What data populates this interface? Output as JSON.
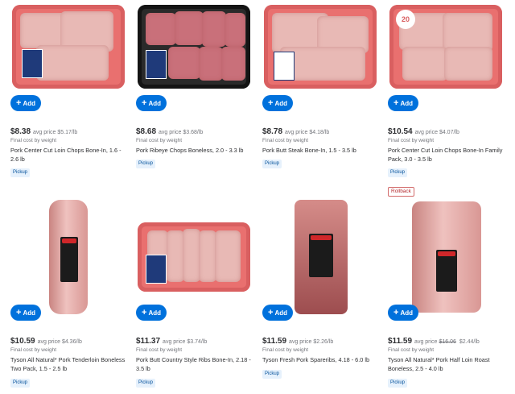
{
  "add_label": "Add",
  "products": [
    {
      "price": "$8.38",
      "avg": "avg price $5.17/lb",
      "final": "Final cost by weight",
      "name": "Pork Center Cut Loin Chops Bone-In, 1.6 - 2.6 lb",
      "pickup": "Pickup"
    },
    {
      "price": "$8.68",
      "avg": "avg price $3.68/lb",
      "final": "Final cost by weight",
      "name": "Pork Ribeye Chops Boneless, 2.0 - 3.3 lb",
      "pickup": "Pickup"
    },
    {
      "price": "$8.78",
      "avg": "avg price $4.18/lb",
      "final": "Final cost by weight",
      "name": "Pork Butt Steak Bone-In, 1.5 - 3.5 lb",
      "pickup": "Pickup"
    },
    {
      "price": "$10.54",
      "avg": "avg price $4.07/lb",
      "final": "Final cost by weight",
      "name": "Pork Center Cut Loin Chops Bone-In Family Pack, 3.0 - 3.5 lb",
      "pickup": "Pickup",
      "image_badge": "20"
    },
    {
      "price": "$10.59",
      "avg": "avg price $4.36/lb",
      "final": "Final cost by weight",
      "name": "Tyson All Natural* Pork Tenderloin Boneless Two Pack, 1.5 - 2.5 lb",
      "pickup": "Pickup"
    },
    {
      "price": "$11.37",
      "avg": "avg price $3.74/lb",
      "final": "Final cost by weight",
      "name": "Pork Butt Country Style Ribs Bone-In, 2.18 - 3.5 lb",
      "pickup": "Pickup"
    },
    {
      "price": "$11.59",
      "avg": "avg price $2.26/lb",
      "final": "Final cost by weight",
      "name": "Tyson Fresh Pork Spareribs, 4.18 - 6.0 lb",
      "pickup": "Pickup"
    },
    {
      "price": "$11.59",
      "avg": "avg price",
      "strike": "$16.06",
      "alt": "$2.44/lb",
      "final": "Final cost by weight",
      "name": "Tyson All Natural* Pork Half Loin Roast Boneless, 2.5 - 4.0 lb",
      "pickup": "Pickup",
      "badge": "Rollback"
    }
  ]
}
